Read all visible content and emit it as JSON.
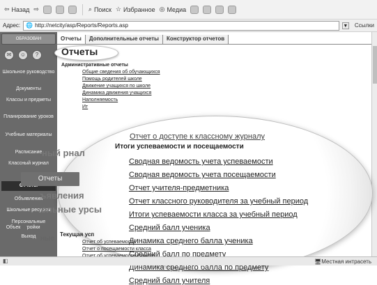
{
  "browser": {
    "back_label": "Назад",
    "search_label": "Поиск",
    "favorites_label": "Избранное",
    "media_label": "Медиа",
    "address_label": "Адрес:",
    "address_url": "http://netcity/asp/Reports/Reports.asp",
    "links_label": "Ссылки",
    "status_zone": "Местная интрасеть"
  },
  "app": {
    "logo_text": "ОБРАЗОВАН",
    "tabs": [
      "Отчеты",
      "Дополнительные отчеты",
      "Конструктор отчетов"
    ],
    "title": "Отчеты",
    "sidebar": [
      {
        "label": "Школьное руководство"
      },
      {
        "label": "Документы"
      },
      {
        "label": "Классы и предметы"
      },
      {
        "label": "Планирование уроков"
      },
      {
        "label": "Учебные материалы"
      },
      {
        "label": "Расписание"
      },
      {
        "label": "Классный журнал"
      },
      {
        "label": "Отчеты"
      },
      {
        "label": "Объявления"
      },
      {
        "label": "Школьные ресурсы"
      },
      {
        "label": "Персональные настройки"
      },
      {
        "label": "Выход"
      }
    ],
    "admin_section": {
      "title": "Административные отчеты",
      "links": [
        "Общие сведения об обучающихся",
        "Помощь родителей школе",
        "Движение учащихся по школе",
        "Динамика движения учащихся",
        "Наполняемость",
        "Ит"
      ]
    },
    "floating": {
      "access_report": "Отчет о доступе к классному журналу",
      "big_journal": "ный рнал",
      "big_reports": "Отчеты",
      "big_announcements": "ъявления",
      "big_resources": "ольные урсы",
      "big_settings": "ные",
      "objects_label": "Объек"
    },
    "magnifier": {
      "section_title": "Итоги успеваемости и посещаемости",
      "links": [
        "Сводная ведомость учета успеваемости",
        "Сводная ведомость учета посещаемости",
        "Отчет учителя-предметника",
        "Отчет классного руководителя за учебный период",
        "Итоги успеваемости класса за учебный период",
        "Средний балл ученика",
        "Динамика среднего балла ученика",
        "Средний балл по предмету",
        "Динамика среднего балла по предмету",
        "Средний балл учителя"
      ]
    },
    "current_section": {
      "title": "Текущая усп",
      "links": [
        "Отчет об успеваемости",
        "Отчет о посещаемости класса",
        "Отчет об успеваемости ученика"
      ]
    }
  }
}
